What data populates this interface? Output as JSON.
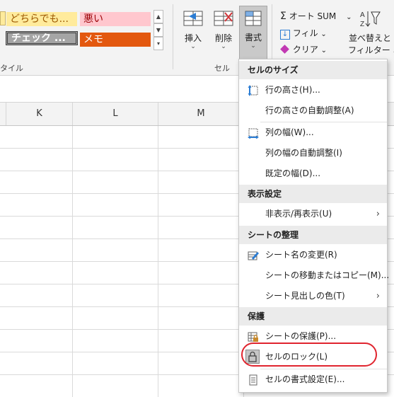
{
  "ribbon": {
    "styles": {
      "cell_neutral": "どちらでも...",
      "cell_bad": "悪い",
      "cell_check": "チェック ...",
      "cell_memo": "メモ",
      "group_label": "タイル"
    },
    "cells_group": {
      "insert_label": "挿入",
      "delete_label": "削除",
      "format_label": "書式",
      "group_label": "セル"
    },
    "editing": {
      "autosum_label": "オート SUM",
      "fill_label": "フィル",
      "clear_label": "クリア",
      "sort_label_line1": "並べ替えと",
      "sort_label_line2": "フィルター"
    }
  },
  "grid": {
    "columns": [
      "K",
      "L",
      "M"
    ]
  },
  "format_menu": {
    "sections": {
      "cell_size": "セルのサイズ",
      "visibility": "表示設定",
      "organize": "シートの整理",
      "protection": "保護"
    },
    "items": {
      "row_height": "行の高さ(H)...",
      "autofit_row": "行の高さの自動調整(A)",
      "column_width": "列の幅(W)...",
      "autofit_column": "列の幅の自動調整(I)",
      "default_width": "既定の幅(D)...",
      "hide_unhide": "非表示/再表示(U)",
      "rename_sheet": "シート名の変更(R)",
      "move_copy": "シートの移動またはコピー(M)...",
      "tab_color": "シート見出しの色(T)",
      "protect_sheet": "シートの保護(P)...",
      "lock_cell": "セルのロック(L)",
      "format_cells": "セルの書式設定(E)..."
    }
  },
  "colors": {
    "neutral_bg": "#ffeb9c",
    "bad_bg": "#ffc7ce",
    "check_bg": "#a5a5a5",
    "memo_bg": "#e3580f",
    "annotation": "#e0242e"
  }
}
